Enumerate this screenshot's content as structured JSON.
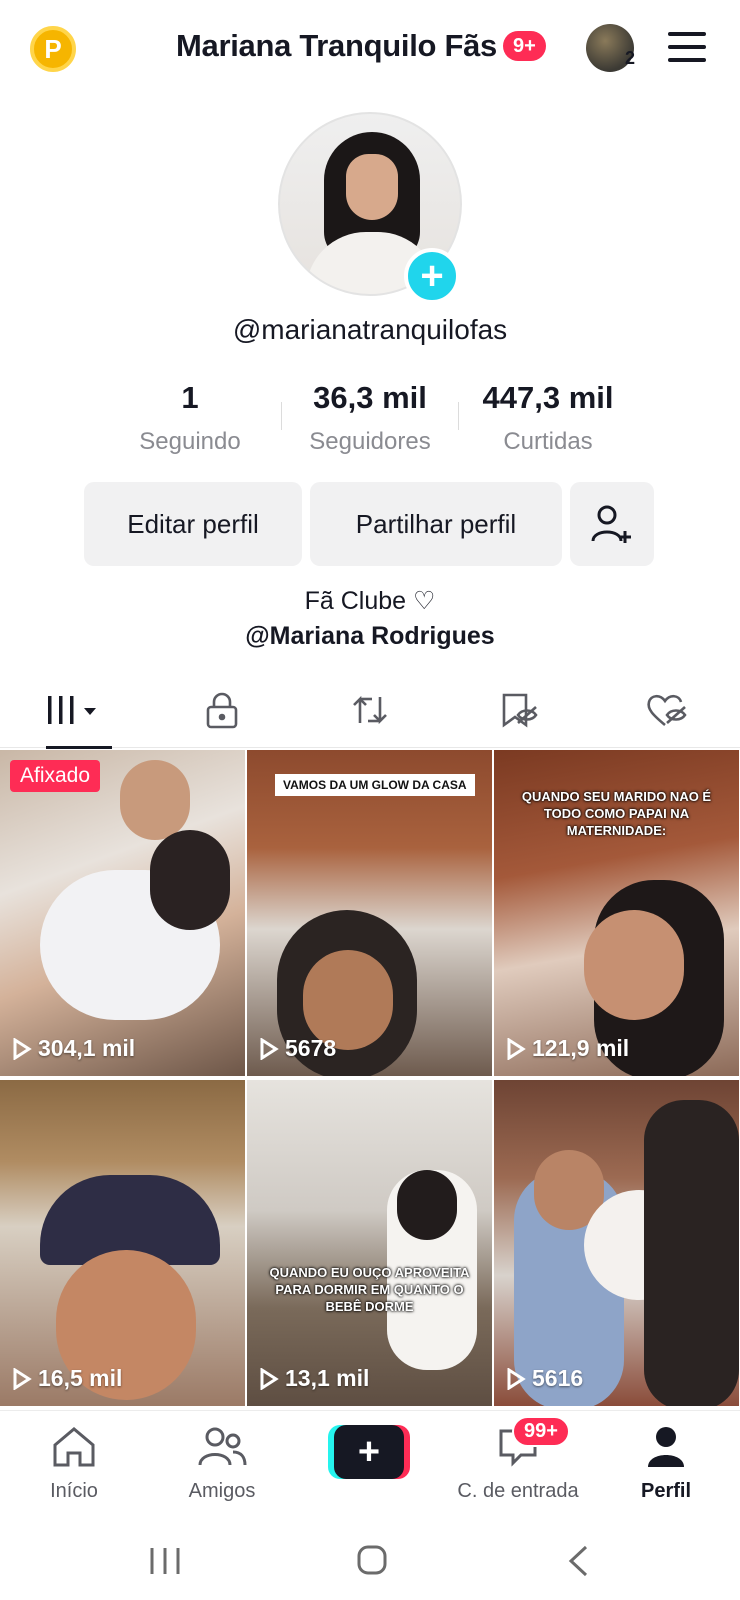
{
  "header": {
    "coin_label": "P",
    "title": "Mariana Tranquilo Fãs",
    "title_badge": "9+",
    "account_count": "2"
  },
  "profile": {
    "username": "@marianatranquilofas",
    "stats": [
      {
        "value": "1",
        "label": "Seguindo"
      },
      {
        "value": "36,3 mil",
        "label": "Seguidores"
      },
      {
        "value": "447,3 mil",
        "label": "Curtidas"
      }
    ],
    "edit_label": "Editar perfil",
    "share_label": "Partilhar perfil",
    "bio_line1": "Fã Clube ♡",
    "bio_line2": "@Mariana Rodrigues"
  },
  "tabs": [
    "videos-grid",
    "private-lock",
    "reposts",
    "favorites",
    "liked"
  ],
  "videos": [
    {
      "views": "304,1 mil",
      "pinned_label": "Afixado",
      "caption": ""
    },
    {
      "views": "5678",
      "caption": "VAMOS DA UM GLOW DA CASA"
    },
    {
      "views": "121,9 mil",
      "caption": "QUANDO SEU MARIDO NAO É TODO COMO PAPAI NA MATERNIDADE:"
    },
    {
      "views": "16,5 mil",
      "caption": ""
    },
    {
      "views": "13,1 mil",
      "caption": "QUANDO EU OUÇO APROVEITA PARA DORMIR EM QUANTO O BEBÊ DORME"
    },
    {
      "views": "5616",
      "caption": ""
    }
  ],
  "bottom_nav": {
    "home": "Início",
    "friends": "Amigos",
    "inbox": "C. de entrada",
    "inbox_badge": "99+",
    "profile": "Perfil"
  },
  "colors": {
    "accent": "#fe2c55",
    "cyan": "#20d5ec",
    "text": "#161823",
    "muted": "#8a8b91"
  }
}
